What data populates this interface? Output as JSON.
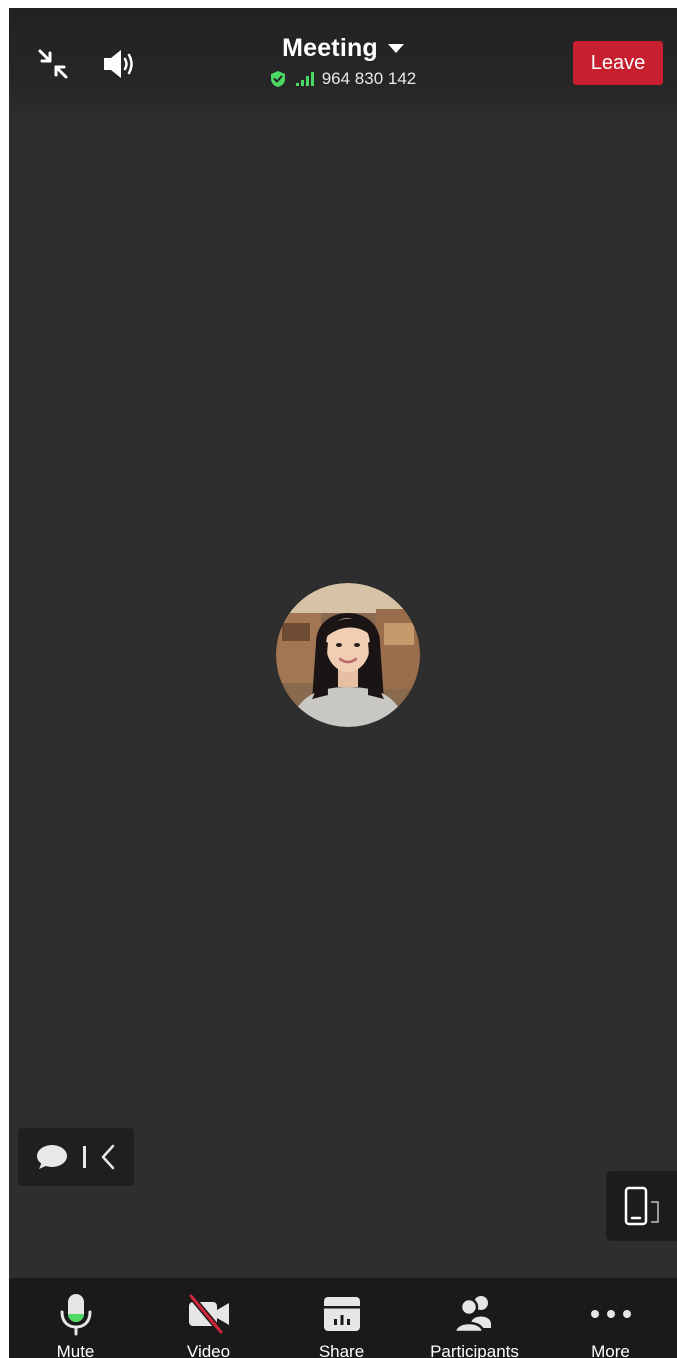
{
  "colors": {
    "stage_background": "#2e2e2e",
    "toolbar_background": "#1a1a1a",
    "leave_button": "#c81f2f",
    "secure_shield": "#4cd964",
    "mic_level": "#4cd964",
    "video_off_slash": "#d0243a"
  },
  "header": {
    "minimize_icon": "collapse-arrows-icon",
    "speaker_icon": "speaker-icon",
    "title": "Meeting",
    "title_dropdown_icon": "caret-down-icon",
    "security_icon": "shield-check-icon",
    "signal_icon": "signal-bars-icon",
    "meeting_id": "964 830 142",
    "leave_label": "Leave"
  },
  "stage": {
    "avatar_icon": "participant-avatar"
  },
  "chat": {
    "chat_icon": "chat-bubble-icon",
    "expand_icon": "chevron-left-icon"
  },
  "view_toggle": {
    "icon": "phone-rotate-icon"
  },
  "toolbar": {
    "items": [
      {
        "label": "Mute",
        "icon": "microphone-icon"
      },
      {
        "label": "Video",
        "icon": "video-off-icon"
      },
      {
        "label": "Share",
        "icon": "share-screen-icon"
      },
      {
        "label": "Participants",
        "icon": "participants-icon"
      },
      {
        "label": "More",
        "icon": "more-dots-icon"
      }
    ]
  }
}
